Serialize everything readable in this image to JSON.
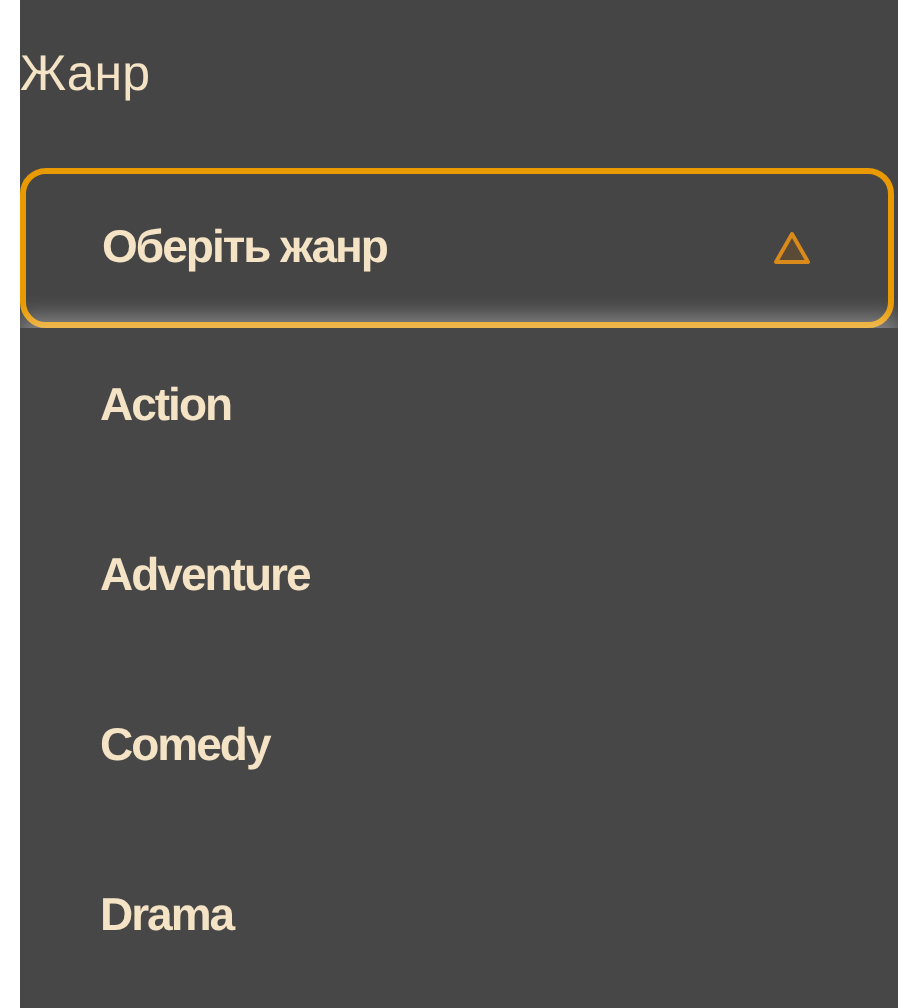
{
  "field": {
    "label": "Жанр"
  },
  "select": {
    "placeholder": "Оберіть жанр",
    "expanded": true
  },
  "options": [
    {
      "label": "Action",
      "selected": false
    },
    {
      "label": "Adventure",
      "selected": false
    },
    {
      "label": "Comedy",
      "selected": false
    },
    {
      "label": "Drama",
      "selected": false
    }
  ]
}
